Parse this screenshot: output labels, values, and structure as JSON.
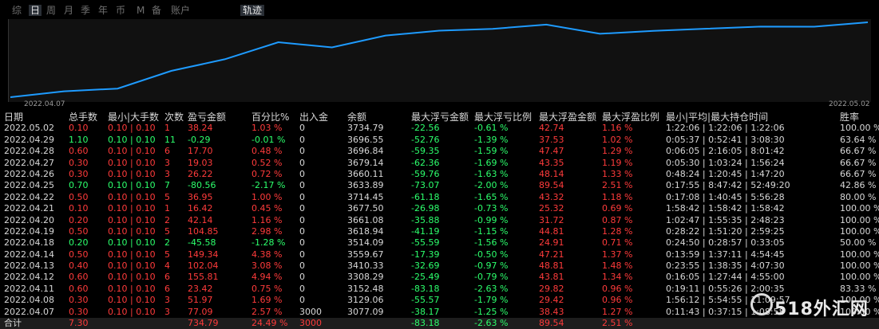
{
  "tabs": {
    "period": [
      "综",
      "日",
      "周",
      "月",
      "季",
      "年",
      "币",
      "M",
      "备",
      "账户"
    ],
    "active_index": 1,
    "trajectory": "轨迹"
  },
  "chart_data": {
    "type": "line",
    "title": "",
    "xlabel": "",
    "ylabel": "",
    "x": [
      "2022.04.07",
      "2022.04.08",
      "2022.04.11",
      "2022.04.12",
      "2022.04.13",
      "2022.04.14",
      "2022.04.18",
      "2022.04.19",
      "2022.04.20",
      "2022.04.21",
      "2022.04.22",
      "2022.04.25",
      "2022.04.26",
      "2022.04.27",
      "2022.04.28",
      "2022.04.29",
      "2022.05.02"
    ],
    "series": [
      {
        "values": [
          3077.09,
          3129.06,
          3152.48,
          3308.29,
          3410.33,
          3559.67,
          3514.09,
          3618.94,
          3661.08,
          3677.5,
          3714.45,
          3633.89,
          3660.11,
          3679.14,
          3696.84,
          3696.55,
          3734.79
        ]
      }
    ],
    "x_start_label": "2022.04.07",
    "x_end_label": "2022.05.02",
    "ylim": [
      3077.09,
      3734.79
    ],
    "line_color": "#1e9bff",
    "grid": false
  },
  "table": {
    "headers": [
      "日期",
      "总手数",
      "最小|大手数",
      "次数",
      "盈亏金额",
      "百分比%",
      "出入金",
      "余额",
      "最大浮亏金额",
      "最大浮亏比例",
      "最大浮盈金额",
      "最大浮盈比例",
      "最小|平均|最大持仓时间",
      "胜率"
    ],
    "rows": [
      {
        "date": "2022.05.02",
        "lots": "0.10",
        "minmax": "0.10 | 0.10",
        "count": "1",
        "pl": "38.24",
        "pct": "1.03 %",
        "flow": "0",
        "bal": "3734.79",
        "mfl": "-22.56",
        "mflp": "-0.61 %",
        "mfp": "42.74",
        "mfpp": "1.16 %",
        "hold": "1:22:06 | 1:22:06 | 1:22:06",
        "win": "100.00 %",
        "sign": "pos"
      },
      {
        "date": "2022.04.29",
        "lots": "1.10",
        "minmax": "0.10 | 0.10",
        "count": "11",
        "pl": "-0.29",
        "pct": "-0.01 %",
        "flow": "0",
        "bal": "3696.55",
        "mfl": "-52.76",
        "mflp": "-1.39 %",
        "mfp": "37.53",
        "mfpp": "1.02 %",
        "hold": "0:05:37 | 0:52:41 | 3:08:30",
        "win": "63.64 %",
        "sign": "neg"
      },
      {
        "date": "2022.04.28",
        "lots": "0.60",
        "minmax": "0.10 | 0.10",
        "count": "6",
        "pl": "17.70",
        "pct": "0.48 %",
        "flow": "0",
        "bal": "3696.84",
        "mfl": "-59.35",
        "mflp": "-1.59 %",
        "mfp": "47.47",
        "mfpp": "1.29 %",
        "hold": "0:06:05 | 2:16:05 | 8:01:42",
        "win": "66.67 %",
        "sign": "pos"
      },
      {
        "date": "2022.04.27",
        "lots": "0.30",
        "minmax": "0.10 | 0.10",
        "count": "3",
        "pl": "19.03",
        "pct": "0.52 %",
        "flow": "0",
        "bal": "3679.14",
        "mfl": "-62.36",
        "mflp": "-1.69 %",
        "mfp": "43.35",
        "mfpp": "1.19 %",
        "hold": "0:05:30 | 1:03:24 | 1:56:24",
        "win": "66.67 %",
        "sign": "pos"
      },
      {
        "date": "2022.04.26",
        "lots": "0.30",
        "minmax": "0.10 | 0.10",
        "count": "3",
        "pl": "26.22",
        "pct": "0.72 %",
        "flow": "0",
        "bal": "3660.11",
        "mfl": "-59.76",
        "mflp": "-1.63 %",
        "mfp": "48.14",
        "mfpp": "1.33 %",
        "hold": "0:48:24 | 1:20:45 | 1:47:20",
        "win": "66.67 %",
        "sign": "pos"
      },
      {
        "date": "2022.04.25",
        "lots": "0.70",
        "minmax": "0.10 | 0.10",
        "count": "7",
        "pl": "-80.56",
        "pct": "-2.17 %",
        "flow": "0",
        "bal": "3633.89",
        "mfl": "-73.07",
        "mflp": "-2.00 %",
        "mfp": "89.54",
        "mfpp": "2.51 %",
        "hold": "0:17:55 | 8:47:42 | 52:49:20",
        "win": "42.86 %",
        "sign": "neg"
      },
      {
        "date": "2022.04.22",
        "lots": "0.50",
        "minmax": "0.10 | 0.10",
        "count": "5",
        "pl": "36.95",
        "pct": "1.00 %",
        "flow": "0",
        "bal": "3714.45",
        "mfl": "-61.18",
        "mflp": "-1.65 %",
        "mfp": "43.32",
        "mfpp": "1.18 %",
        "hold": "0:17:08 | 1:40:45 | 5:56:28",
        "win": "80.00 %",
        "sign": "pos"
      },
      {
        "date": "2022.04.21",
        "lots": "0.10",
        "minmax": "0.10 | 0.10",
        "count": "1",
        "pl": "16.42",
        "pct": "0.45 %",
        "flow": "0",
        "bal": "3677.50",
        "mfl": "-26.98",
        "mflp": "-0.73 %",
        "mfp": "25.32",
        "mfpp": "0.69 %",
        "hold": "1:58:42 | 1:58:42 | 1:58:42",
        "win": "100.00 %",
        "sign": "pos"
      },
      {
        "date": "2022.04.20",
        "lots": "0.20",
        "minmax": "0.10 | 0.10",
        "count": "2",
        "pl": "42.14",
        "pct": "1.16 %",
        "flow": "0",
        "bal": "3661.08",
        "mfl": "-35.88",
        "mflp": "-0.99 %",
        "mfp": "31.72",
        "mfpp": "0.87 %",
        "hold": "1:02:47 | 1:55:35 | 2:48:23",
        "win": "100.00 %",
        "sign": "pos"
      },
      {
        "date": "2022.04.19",
        "lots": "0.50",
        "minmax": "0.10 | 0.10",
        "count": "5",
        "pl": "104.85",
        "pct": "2.98 %",
        "flow": "0",
        "bal": "3618.94",
        "mfl": "-41.19",
        "mflp": "-1.15 %",
        "mfp": "44.81",
        "mfpp": "1.28 %",
        "hold": "0:28:22 | 1:51:20 | 2:59:25",
        "win": "100.00 %",
        "sign": "pos"
      },
      {
        "date": "2022.04.18",
        "lots": "0.20",
        "minmax": "0.10 | 0.10",
        "count": "2",
        "pl": "-45.58",
        "pct": "-1.28 %",
        "flow": "0",
        "bal": "3514.09",
        "mfl": "-55.59",
        "mflp": "-1.56 %",
        "mfp": "24.91",
        "mfpp": "0.71 %",
        "hold": "0:24:50 | 0:28:57 | 0:33:05",
        "win": "50.00 %",
        "sign": "neg"
      },
      {
        "date": "2022.04.14",
        "lots": "0.50",
        "minmax": "0.10 | 0.10",
        "count": "5",
        "pl": "149.34",
        "pct": "4.38 %",
        "flow": "0",
        "bal": "3559.67",
        "mfl": "-17.39",
        "mflp": "-0.50 %",
        "mfp": "47.21",
        "mfpp": "1.37 %",
        "hold": "0:13:59 | 1:37:11 | 4:54:45",
        "win": "100.00 %",
        "sign": "pos"
      },
      {
        "date": "2022.04.13",
        "lots": "0.40",
        "minmax": "0.10 | 0.10",
        "count": "4",
        "pl": "102.04",
        "pct": "3.08 %",
        "flow": "0",
        "bal": "3410.33",
        "mfl": "-32.69",
        "mflp": "-0.97 %",
        "mfp": "48.81",
        "mfpp": "1.48 %",
        "hold": "0:23:55 | 1:38:35 | 4:07:30",
        "win": "100.00 %",
        "sign": "pos"
      },
      {
        "date": "2022.04.12",
        "lots": "0.60",
        "minmax": "0.10 | 0.10",
        "count": "6",
        "pl": "155.81",
        "pct": "4.94 %",
        "flow": "0",
        "bal": "3308.29",
        "mfl": "-25.49",
        "mflp": "-0.79 %",
        "mfp": "43.81",
        "mfpp": "1.34 %",
        "hold": "0:16:05 | 1:27:44 | 4:55:00",
        "win": "100.00 %",
        "sign": "pos"
      },
      {
        "date": "2022.04.11",
        "lots": "0.60",
        "minmax": "0.10 | 0.10",
        "count": "6",
        "pl": "23.42",
        "pct": "0.75 %",
        "flow": "0",
        "bal": "3152.48",
        "mfl": "-83.18",
        "mflp": "-2.63 %",
        "mfp": "29.82",
        "mfpp": "0.96 %",
        "hold": "0:19:11 | 0:55:26 | 2:00:35",
        "win": "83.33 %",
        "sign": "pos"
      },
      {
        "date": "2022.04.08",
        "lots": "0.30",
        "minmax": "0.10 | 0.10",
        "count": "3",
        "pl": "51.97",
        "pct": "1.69 %",
        "flow": "0",
        "bal": "3129.06",
        "mfl": "-55.57",
        "mflp": "-1.79 %",
        "mfp": "29.42",
        "mfpp": "0.96 %",
        "hold": "1:56:12 | 5:54:55 | 11:09:57",
        "win": "100.00 %",
        "sign": "pos"
      },
      {
        "date": "2022.04.07",
        "lots": "0.30",
        "minmax": "0.10 | 0.10",
        "count": "3",
        "pl": "77.09",
        "pct": "2.57 %",
        "flow": "3000",
        "bal": "3077.09",
        "mfl": "-38.17",
        "mflp": "-1.25 %",
        "mfp": "38.43",
        "mfpp": "1.27 %",
        "hold": "0:11:43 | 0:37:15 | 1:08:58",
        "win": "100.00 %",
        "sign": "pos"
      }
    ],
    "total": {
      "label": "合计",
      "lots": "7.30",
      "pl": "734.79",
      "pct": "24.49 %",
      "flow": "3000",
      "mfl": "-83.18",
      "mflp": "-2.63 %",
      "mfp": "89.54",
      "mfpp": "2.51 %"
    }
  },
  "watermark": {
    "text": "518外汇网"
  }
}
